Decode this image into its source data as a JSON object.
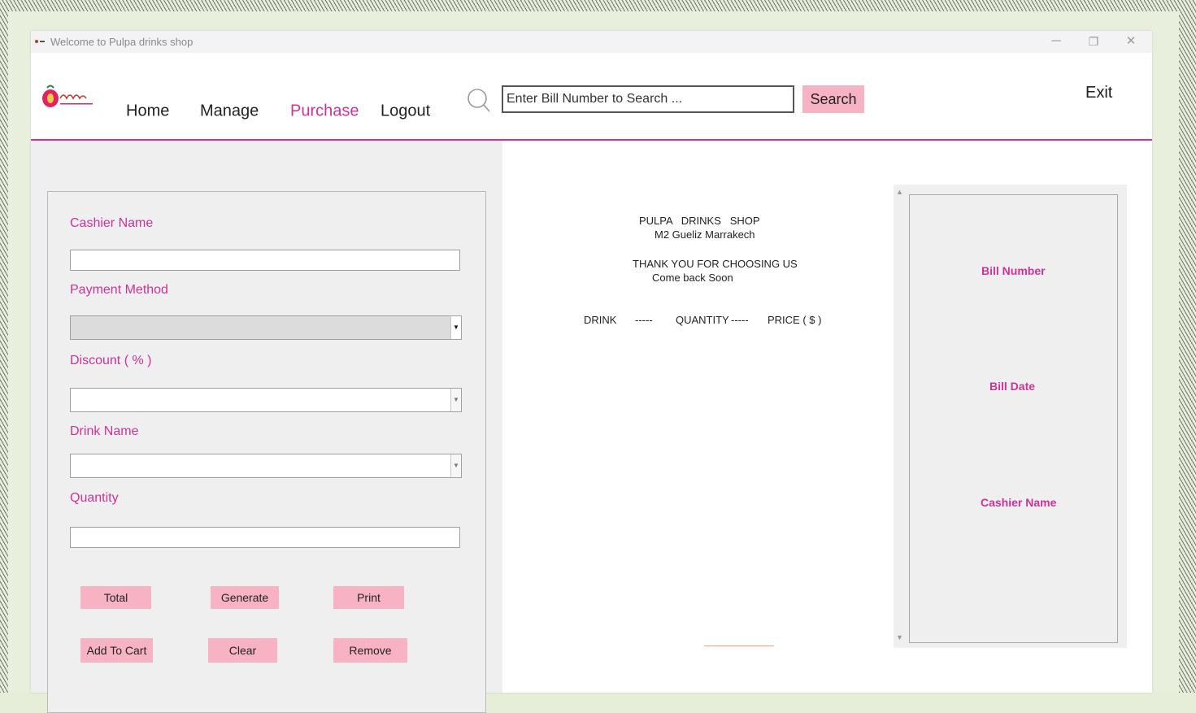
{
  "window": {
    "title": "Welcome to Pulpa drinks shop",
    "controls": {
      "minimize": "─",
      "maximize": "❐",
      "close": "✕"
    }
  },
  "nav": {
    "items": [
      {
        "label": "Home",
        "active": false
      },
      {
        "label": "Manage",
        "active": false
      },
      {
        "label": "Purchase",
        "active": true
      },
      {
        "label": "Logout",
        "active": false
      }
    ],
    "search_placeholder": "Enter Bill Number to Search ...",
    "search_button": "Search",
    "exit": "Exit"
  },
  "form": {
    "cashier_label": "Cashier Name",
    "cashier_value": "",
    "payment_label": "Payment Method",
    "payment_value": "",
    "discount_label": "Discount ( % )",
    "discount_value": "",
    "drink_label": "Drink Name",
    "drink_value": "",
    "quantity_label": "Quantity",
    "quantity_value": "",
    "buttons": {
      "total": "Total",
      "generate": "Generate",
      "print": "Print",
      "add_to_cart": "Add To Cart",
      "clear": "Clear",
      "remove": "Remove"
    }
  },
  "receipt": {
    "shop_name": "PULPA   DRINKS   SHOP",
    "address": "M2 Gueliz Marrakech",
    "thanks": "THANK YOU FOR CHOOSING US",
    "come_back": "Come back Soon",
    "col_drink": "DRINK",
    "sep1": "-----",
    "col_quantity": "QUANTITY",
    "sep2": "-----",
    "col_price": "PRICE ( $ )"
  },
  "bill_info": {
    "bill_number": "Bill Number",
    "bill_date": "Bill Date",
    "cashier_name": "Cashier Name"
  },
  "colors": {
    "accent": "#cc3399",
    "button_pink": "#f7b3c4",
    "panel_gray": "#efefef"
  }
}
